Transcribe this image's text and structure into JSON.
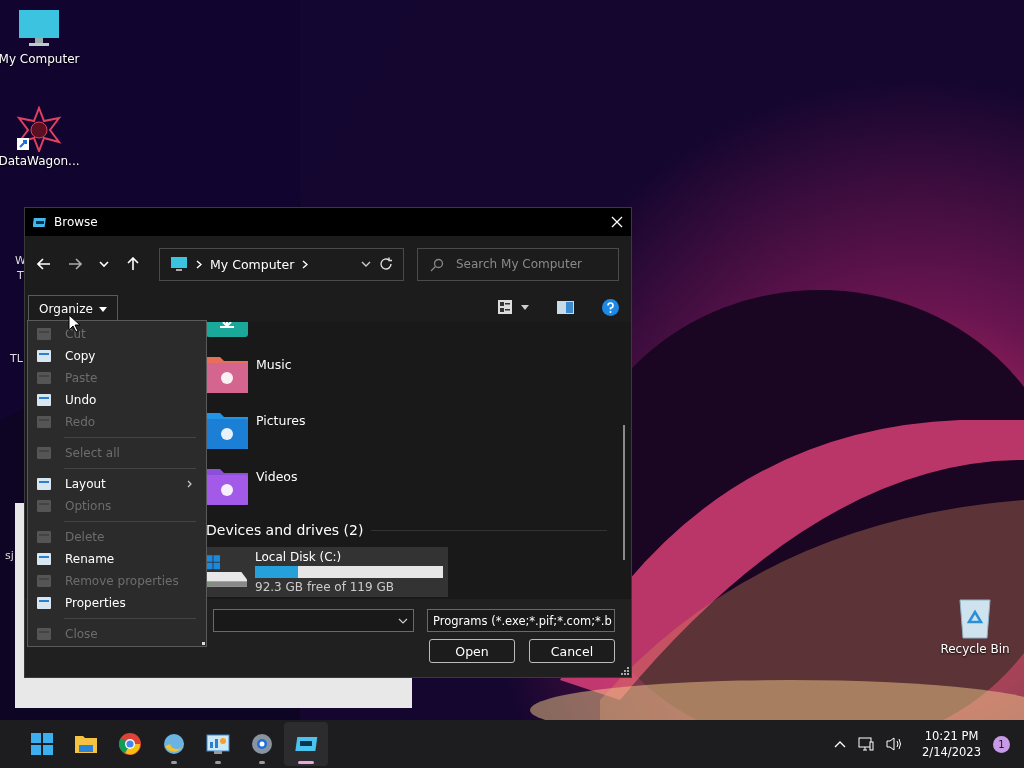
{
  "desktop_icons": [
    {
      "label": "My Computer"
    },
    {
      "label": "DataWagon..."
    },
    {
      "label": "W"
    },
    {
      "label": "T"
    },
    {
      "label": "TL"
    },
    {
      "label": "sj"
    },
    {
      "label": "Recycle Bin"
    }
  ],
  "dialog": {
    "title": "Browse",
    "breadcrumb": "My Computer",
    "search": {
      "placeholder": "Search My Computer"
    },
    "organize": "Organize",
    "items": [
      {
        "name": "Music"
      },
      {
        "name": "Pictures"
      },
      {
        "name": "Videos"
      }
    ],
    "group_header": "Devices and drives (2)",
    "drive": {
      "name": "Local Disk (C:)",
      "level": 0.23,
      "free": "92.3 GB free of 119 GB",
      "selected": true
    },
    "filter": "Programs (*.exe;*.pif;*.com;*.b",
    "buttons": [
      "Open",
      "Cancel"
    ]
  },
  "menu": [
    {
      "kind": "item",
      "label": "Cut",
      "disabled": true
    },
    {
      "kind": "item",
      "label": "Copy",
      "disabled": false
    },
    {
      "kind": "item",
      "label": "Paste",
      "disabled": true
    },
    {
      "kind": "item",
      "label": "Undo",
      "disabled": false
    },
    {
      "kind": "item",
      "label": "Redo",
      "disabled": true
    },
    {
      "kind": "separator"
    },
    {
      "kind": "item",
      "label": "Select all",
      "disabled": true
    },
    {
      "kind": "separator"
    },
    {
      "kind": "submenu",
      "label": "Layout",
      "disabled": false
    },
    {
      "kind": "item",
      "label": "Options",
      "disabled": true
    },
    {
      "kind": "separator"
    },
    {
      "kind": "item",
      "label": "Delete",
      "disabled": true
    },
    {
      "kind": "item",
      "label": "Rename",
      "disabled": false
    },
    {
      "kind": "item",
      "label": "Remove properties",
      "disabled": true
    },
    {
      "kind": "item",
      "label": "Properties",
      "disabled": false
    },
    {
      "kind": "separator"
    },
    {
      "kind": "item",
      "label": "Close",
      "disabled": true
    }
  ],
  "taskbar": {
    "apps": [
      {
        "running": false,
        "active": false
      },
      {
        "running": false,
        "active": false
      },
      {
        "running": false,
        "active": false
      },
      {
        "running": true,
        "active": false
      },
      {
        "running": true,
        "active": false
      },
      {
        "running": true,
        "active": false
      },
      {
        "running": true,
        "active": true
      }
    ],
    "time": "10:21 PM",
    "date": "2/14/2023",
    "notifications": "1"
  }
}
